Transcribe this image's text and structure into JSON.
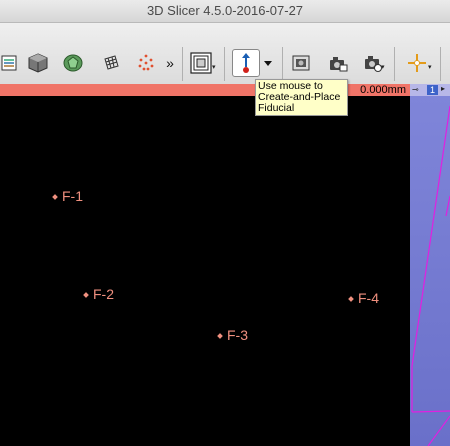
{
  "window": {
    "title": "3D Slicer 4.5.0-2016-07-27"
  },
  "toolbar": {
    "overflow_label": "»",
    "tooltip": "Use mouse to Create-and-Place Fiducial"
  },
  "slice_view": {
    "readout": "0.000mm",
    "fiducials": [
      {
        "label": "F-1"
      },
      {
        "label": "F-2"
      },
      {
        "label": "F-3"
      },
      {
        "label": "F-4"
      }
    ]
  },
  "view3d": {
    "view_number": "1"
  },
  "colors": {
    "slice_bar": "#f07468",
    "fiducial": "#f0907f",
    "view3d_bg": "#7f85d9",
    "view3d_lines": "#e020e0"
  }
}
